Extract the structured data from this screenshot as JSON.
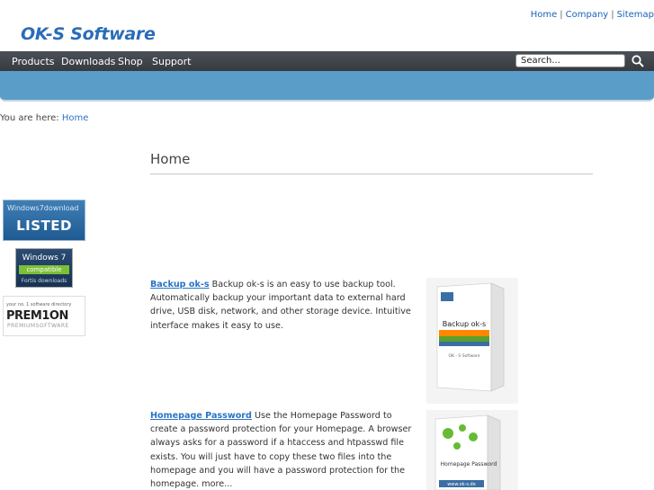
{
  "toplinks": {
    "home": "Home",
    "company": "Company",
    "sitemap": "Sitemap",
    "sep": "|"
  },
  "logo": {
    "text": "OK-S Software"
  },
  "nav": {
    "items": [
      "Products",
      "Downloads",
      "Shop",
      "Support"
    ]
  },
  "search": {
    "placeholder": "Search..."
  },
  "breadcrumb": {
    "prefix": "You are here:",
    "current": "Home"
  },
  "page": {
    "title": "Home"
  },
  "badges": {
    "windows7_download": {
      "line1": "Windows7download",
      "line2": "LISTED"
    },
    "windows7_compatible": {
      "line1": "Windows 7",
      "line2": "compatible",
      "line3": "Fortis downloads"
    },
    "premion": {
      "line1": "your no. 1 software directory",
      "line2": "PREM1ON",
      "line3": "PREMIUMSOFTWARE"
    }
  },
  "products": [
    {
      "name": "Backup ok-s",
      "description": "Backup ok-s is an easy to use backup tool. Automatically backup your important data to external hard drive, USB disk, network, and other storage device. Intuitive interface makes it easy to use.",
      "box_label": "Backup ok-s",
      "box_sub": "OK - S Software"
    },
    {
      "name": "Homepage Password",
      "description": "Use the Homepage Password to create a password protection for your Homepage. A browser always asks for a password if a htaccess and htpasswd file exists. You will just have to copy these two files into the homepage and you will have a password protection for the homepage. more...",
      "box_label": "Homepage Password",
      "box_sub": "www.ok-s.de"
    }
  ],
  "colors": {
    "navbar": "#3f454b",
    "banner": "#5b9dc9",
    "link": "#2a74c4",
    "logo": "#2a6cb8"
  }
}
